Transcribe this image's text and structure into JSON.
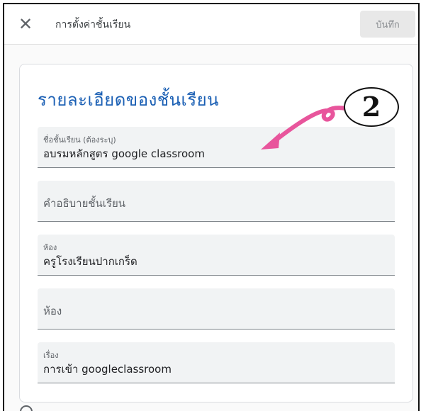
{
  "topbar": {
    "close_icon": "close-icon",
    "title": "การตั้งค่าชั้นเรียน",
    "save_label": "บันทึก"
  },
  "card": {
    "title": "รายละเอียดของชั้นเรียน",
    "fields": [
      {
        "label": "ชื่อชั้นเรียน (ต้องระบุ)",
        "value": "อบรมหลักสูตร google classroom"
      },
      {
        "placeholder": "คำอธิบายชั้นเรียน"
      },
      {
        "label": "ห้อง",
        "value": "ครูโรงเรียนปากเกร็ด"
      },
      {
        "placeholder": "ห้อง"
      },
      {
        "label": "เรื่อง",
        "value": "การเข้า googleclassroom"
      }
    ]
  },
  "annotation": {
    "number": "2",
    "arrow_color": "#e8559c"
  },
  "colors": {
    "accent": "#1a5fb4",
    "field_bg": "#f1f3f4"
  }
}
